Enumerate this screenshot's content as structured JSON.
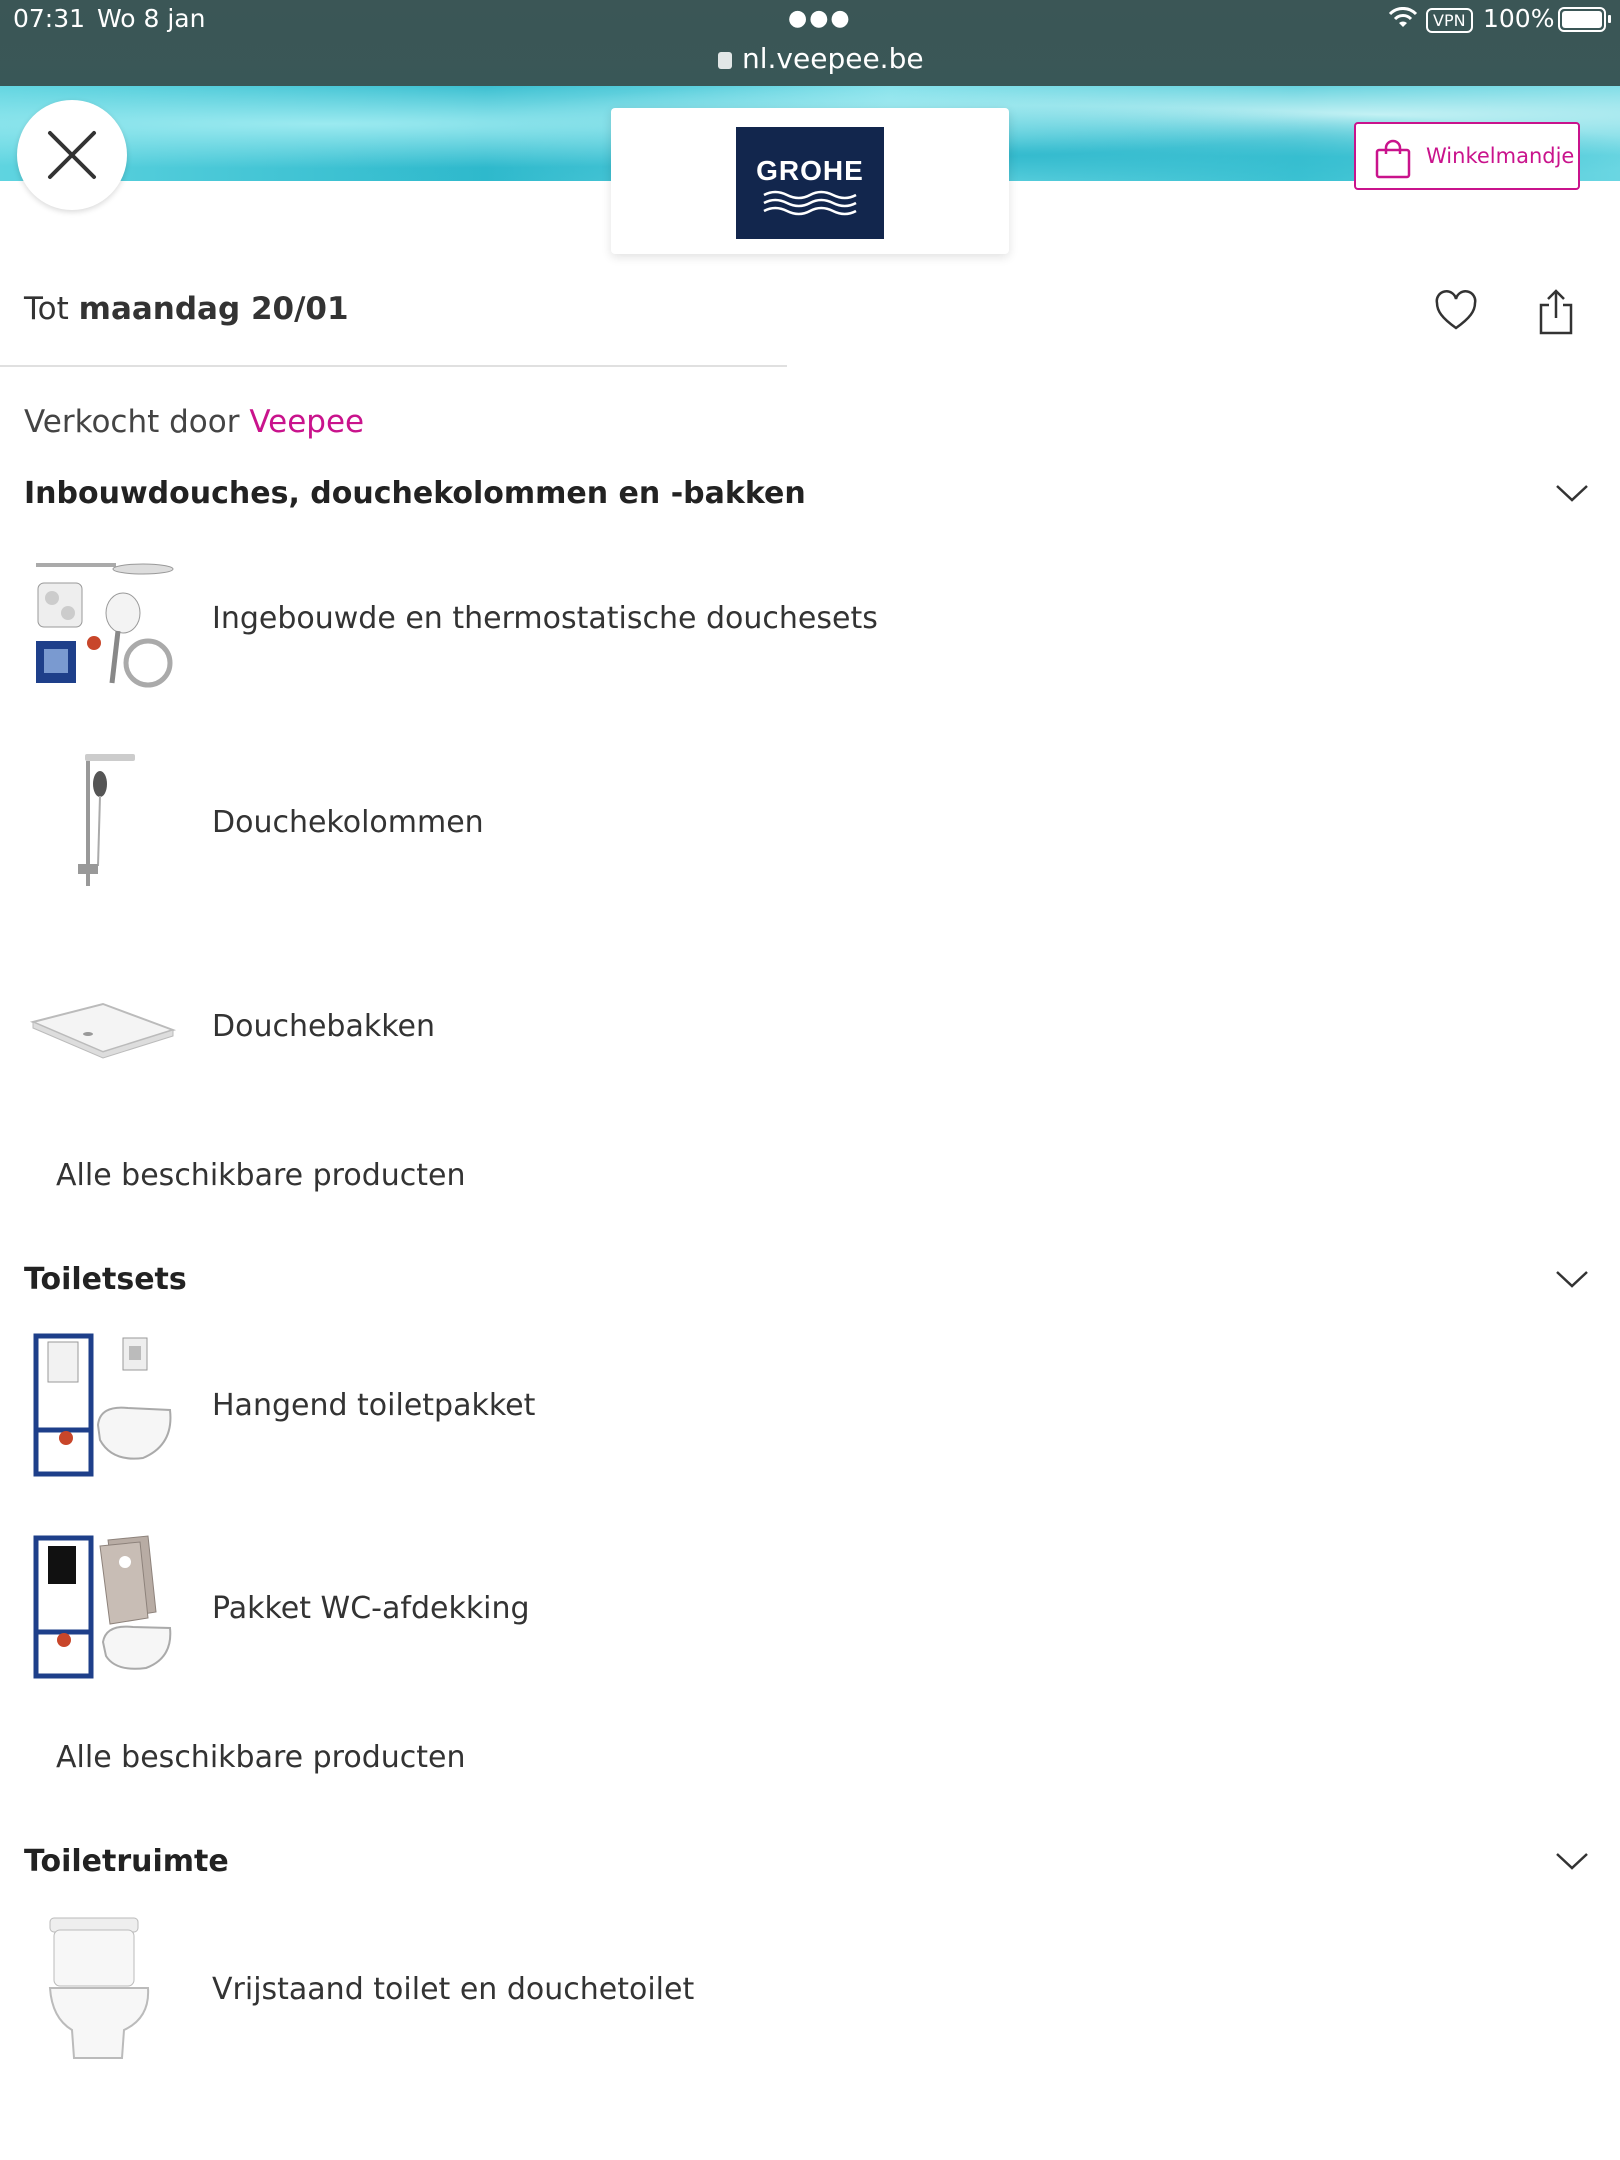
{
  "status": {
    "time": "07:31",
    "date": "Wo 8 jan",
    "url": "nl.veepee.be",
    "vpn": "VPN",
    "battery": "100%"
  },
  "header": {
    "logo_text": "GROHE",
    "cart_label": "Winkelmandje"
  },
  "sale": {
    "deadline_prefix": "Tot",
    "deadline_date": "maandag 20/01",
    "sold_by_prefix": "Verkocht door",
    "sold_by_brand": "Veepee"
  },
  "sections": [
    {
      "title": "Inbouwdouches, douchekolommen en -bakken",
      "items": [
        {
          "label": "Ingebouwde en thermostatische douchesets",
          "icon": "shower-set-image"
        },
        {
          "label": "Douchekolommen",
          "icon": "shower-column-image"
        },
        {
          "label": "Douchebakken",
          "icon": "shower-tray-image"
        }
      ],
      "all_label": "Alle beschikbare producten"
    },
    {
      "title": "Toiletsets",
      "items": [
        {
          "label": "Hangend toiletpakket",
          "icon": "wall-hung-toilet-image"
        },
        {
          "label": "Pakket WC-afdekking",
          "icon": "toilet-cover-package-image"
        }
      ],
      "all_label": "Alle beschikbare producten"
    },
    {
      "title": "Toiletruimte",
      "items": [
        {
          "label": "Vrijstaand toilet en douchetoilet",
          "icon": "freestanding-toilet-image"
        }
      ]
    }
  ],
  "colors": {
    "accent": "#c9138c",
    "logo_bg": "#12264d",
    "statusbar": "#3b5656"
  }
}
